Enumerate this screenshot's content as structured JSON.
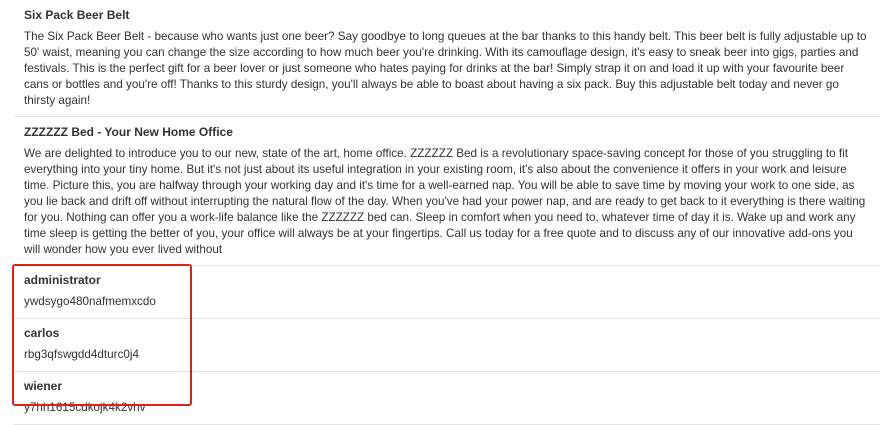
{
  "results": [
    {
      "title": "Six Pack Beer Belt",
      "body": "The Six Pack Beer Belt - because who wants just one beer? Say goodbye to long queues at the bar thanks to this handy belt. This beer belt is fully adjustable up to 50' waist, meaning you can change the size according to how much beer you're drinking. With its camouflage design, it's easy to sneak beer into gigs, parties and festivals. This is the perfect gift for a beer lover or just someone who hates paying for drinks at the bar! Simply strap it on and load it up with your favourite beer cans or bottles and you're off! Thanks to this sturdy design, you'll always be able to boast about having a six pack. Buy this adjustable belt today and never go thirsty again!"
    },
    {
      "title": "ZZZZZZ Bed - Your New Home Office",
      "body": "We are delighted to introduce you to our new, state of the art, home office. ZZZZZZ Bed is a revolutionary space-saving concept for those of you struggling to fit everything into your tiny home. But it's not just about its useful integration in your existing room, it's also about the convenience it offers in your work and leisure time. Picture this, you are halfway through your working day and it's time for a well-earned nap. You will be able to save time by moving your work to one side, as you lie back and drift off without interrupting the natural flow of the day. When you've had your power nap, and are ready to get back to it everything is there waiting for you. Nothing can offer you a work-life balance like the ZZZZZZ bed can. Sleep in comfort when you need to, whatever time of day it is. Wake up and work any time sleep is getting the better of you, your office will always be at your fingertips. Call us today for a free quote and to discuss any of our innovative add-ons you will wonder how you ever lived without"
    },
    {
      "title": "administrator",
      "body": "ywdsygo480nafmemxcdo"
    },
    {
      "title": "carlos",
      "body": "rbg3qfswgdd4dturc0j4"
    },
    {
      "title": "wiener",
      "body": "y7hh1615cdkojk4k2vhv"
    }
  ],
  "colors": {
    "text": "#333333",
    "divider": "#e3e3e3",
    "highlight": "#e0201b"
  }
}
